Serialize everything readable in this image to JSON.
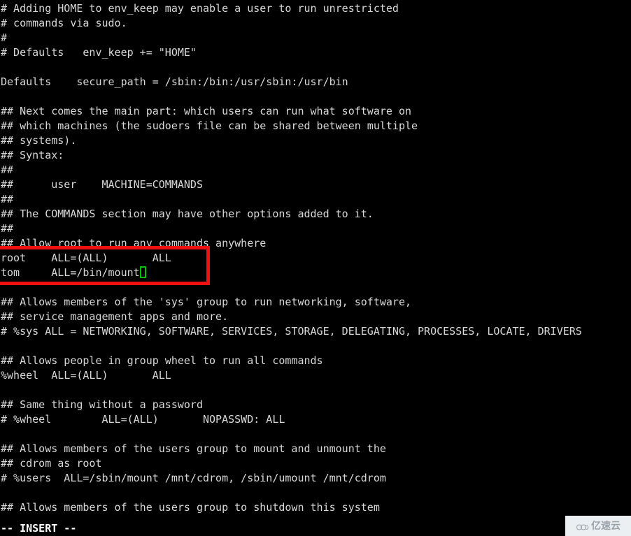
{
  "terminal": {
    "app": "vim",
    "background_color": "#000000",
    "foreground_color": "#d8d8d8",
    "cursor_color": "#00c000",
    "annotation_color": "#ee1111",
    "lines": [
      "# Adding HOME to env_keep may enable a user to run unrestricted",
      "# commands via sudo.",
      "#",
      "# Defaults   env_keep += \"HOME\"",
      "",
      "Defaults    secure_path = /sbin:/bin:/usr/sbin:/usr/bin",
      "",
      "## Next comes the main part: which users can run what software on",
      "## which machines (the sudoers file can be shared between multiple",
      "## systems).",
      "## Syntax:",
      "##",
      "##      user    MACHINE=COMMANDS",
      "##",
      "## The COMMANDS section may have other options added to it.",
      "##",
      "## Allow root to run any commands anywhere",
      "root    ALL=(ALL)       ALL",
      "tom     ALL=/bin/mount",
      "",
      "## Allows members of the 'sys' group to run networking, software,",
      "## service management apps and more.",
      "# %sys ALL = NETWORKING, SOFTWARE, SERVICES, STORAGE, DELEGATING, PROCESSES, LOCATE, DRIVERS",
      "",
      "## Allows people in group wheel to run all commands",
      "%wheel  ALL=(ALL)       ALL",
      "",
      "## Same thing without a password",
      "# %wheel        ALL=(ALL)       NOPASSWD: ALL",
      "",
      "## Allows members of the users group to mount and unmount the",
      "## cdrom as root",
      "# %users  ALL=/sbin/mount /mnt/cdrom, /sbin/umount /mnt/cdrom",
      "",
      "## Allows members of the users group to shutdown this system"
    ],
    "cursor": {
      "line_index": 18,
      "after_text": "tom     ALL=/bin/mount"
    },
    "status_line": "-- INSERT --"
  },
  "watermark": {
    "text": "亿速云",
    "icon": "cloud-icon",
    "color": "#9aa3ab",
    "background": "#eceff1"
  }
}
